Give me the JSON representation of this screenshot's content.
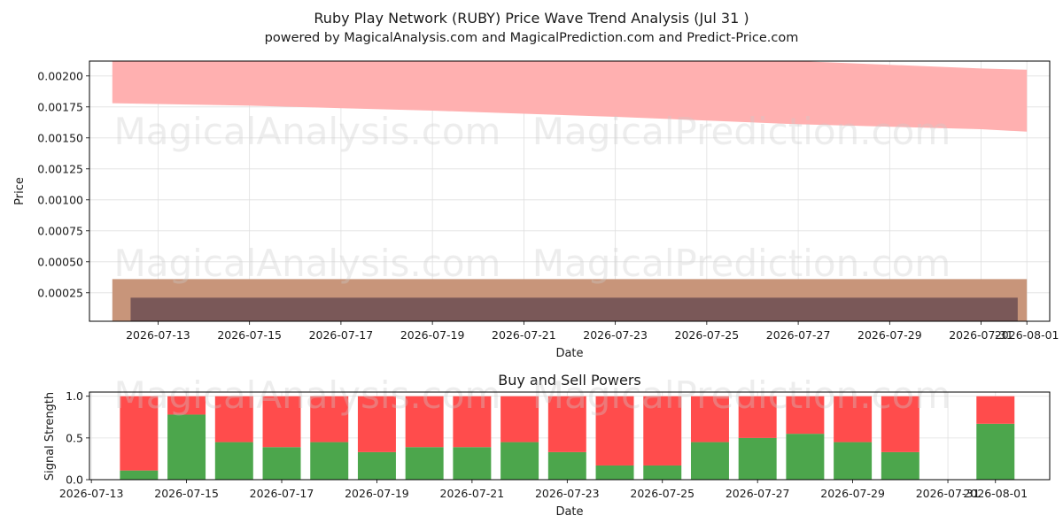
{
  "header": {
    "title": "Ruby Play Network (RUBY) Price Wave Trend Analysis (Jul 31 )",
    "subtitle": "powered by MagicalAnalysis.com and MagicalPrediction.com and Predict-Price.com"
  },
  "watermarks": [
    "MagicalAnalysis.com",
    "MagicalPrediction.com"
  ],
  "colors": {
    "upper_band": "#ffb0b0",
    "lower_band_outer": "#c8957a",
    "lower_band_inner": "#7a5858",
    "buy": "#4ca64c",
    "sell": "#ff4c4c",
    "grid": "#e0e0e0"
  },
  "chart_data": [
    {
      "type": "area",
      "title": "",
      "xlabel": "Date",
      "ylabel": "Price",
      "grid": true,
      "x_ticks": [
        "2026-07-13",
        "2026-07-15",
        "2026-07-17",
        "2026-07-19",
        "2026-07-21",
        "2026-07-23",
        "2026-07-25",
        "2026-07-27",
        "2026-07-29",
        "2026-07-31",
        "2026-08-01"
      ],
      "y_ticks": [
        "0.00025",
        "0.00050",
        "0.00075",
        "0.00100",
        "0.00125",
        "0.00150",
        "0.00175",
        "0.00200"
      ],
      "ylim": [
        2e-05,
        0.00212
      ],
      "x_range": [
        "2026-07-12",
        "2026-08-01"
      ],
      "series": [
        {
          "kind": "upper_band",
          "x": [
            "2026-07-12",
            "2026-07-15",
            "2026-07-19",
            "2026-07-23",
            "2026-07-27",
            "2026-07-31",
            "2026-08-01"
          ],
          "upper": [
            0.00212,
            0.00212,
            0.00212,
            0.00212,
            0.00212,
            0.00206,
            0.00205
          ],
          "lower": [
            0.00178,
            0.00176,
            0.00172,
            0.00167,
            0.00161,
            0.00157,
            0.00155
          ]
        },
        {
          "kind": "lower_band_outer",
          "x": [
            "2026-07-12",
            "2026-08-01"
          ],
          "upper": [
            0.00036,
            0.00036
          ],
          "lower": [
            2e-05,
            2e-05
          ]
        },
        {
          "kind": "lower_band_inner",
          "x": [
            "2026-07-12.4",
            "2026-07-31.8"
          ],
          "upper": [
            0.00021,
            0.00021
          ],
          "lower": [
            2e-05,
            2e-05
          ]
        }
      ]
    },
    {
      "type": "bar",
      "title": "Buy and Sell Powers",
      "xlabel": "Date",
      "ylabel": "Signal Strength",
      "grid": true,
      "x_ticks": [
        "2026-07-13",
        "2026-07-15",
        "2026-07-17",
        "2026-07-19",
        "2026-07-21",
        "2026-07-23",
        "2026-07-25",
        "2026-07-27",
        "2026-07-29",
        "2026-07-31",
        "2026-08-01"
      ],
      "y_ticks": [
        "0.0",
        "0.5",
        "1.0"
      ],
      "ylim": [
        0,
        1.05
      ],
      "x_range": [
        "2026-07-13",
        "2026-08-01"
      ],
      "categories": [
        "2026-07-14",
        "2026-07-15",
        "2026-07-16",
        "2026-07-17",
        "2026-07-18",
        "2026-07-19",
        "2026-07-20",
        "2026-07-21",
        "2026-07-22",
        "2026-07-23",
        "2026-07-24",
        "2026-07-25",
        "2026-07-26",
        "2026-07-27",
        "2026-07-28",
        "2026-07-29",
        "2026-07-30",
        "2026-08-01"
      ],
      "series": [
        {
          "kind": "buy",
          "values": [
            0.11,
            0.78,
            0.45,
            0.39,
            0.45,
            0.33,
            0.39,
            0.39,
            0.45,
            0.33,
            0.17,
            0.17,
            0.45,
            0.5,
            0.55,
            0.45,
            0.33,
            0.67
          ]
        },
        {
          "kind": "sell",
          "values": [
            0.89,
            0.22,
            0.55,
            0.61,
            0.55,
            0.67,
            0.61,
            0.61,
            0.55,
            0.67,
            0.83,
            0.83,
            0.55,
            0.5,
            0.45,
            0.55,
            0.67,
            0.33
          ]
        }
      ]
    }
  ]
}
